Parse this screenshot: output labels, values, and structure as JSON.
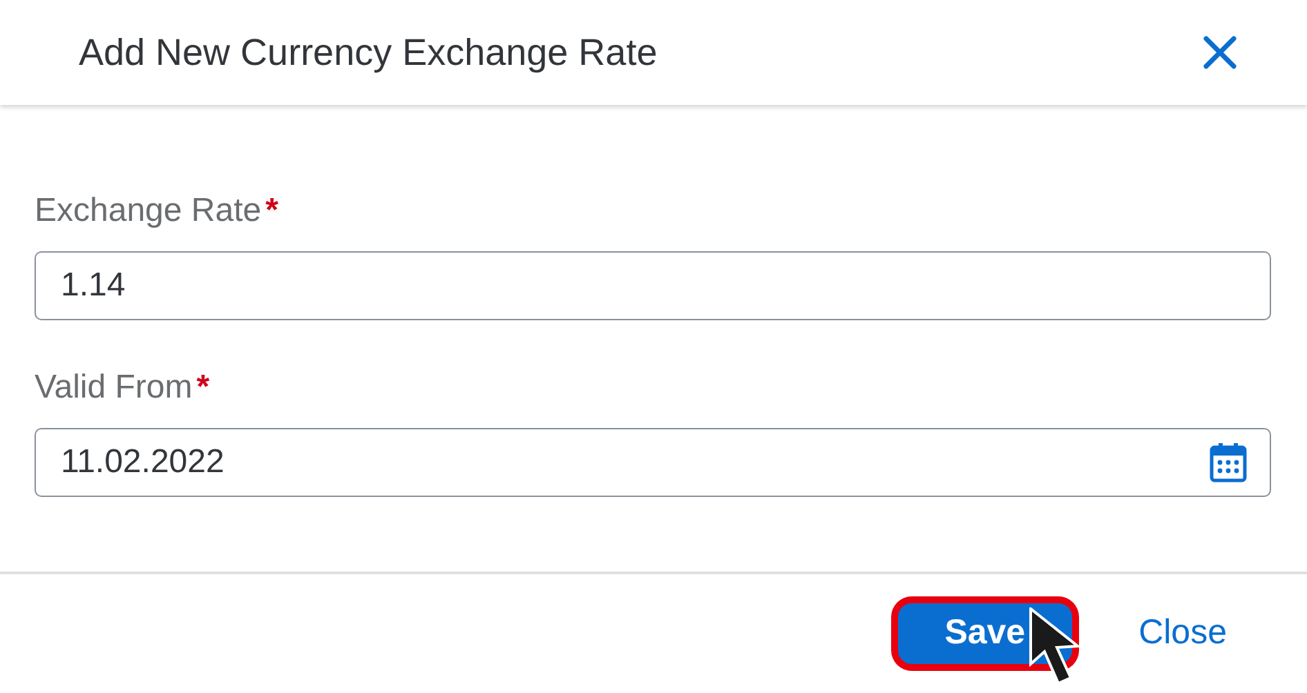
{
  "dialog": {
    "title": "Add New Currency Exchange Rate"
  },
  "fields": [
    {
      "label": "Exchange Rate",
      "required_mark": "*",
      "value": "1.14",
      "kind": "text"
    },
    {
      "label": "Valid From",
      "required_mark": "*",
      "value": "11.02.2022",
      "kind": "date"
    }
  ],
  "buttons": [
    {
      "label": "Save",
      "kind": "primary",
      "highlighted": true
    },
    {
      "label": "Close",
      "kind": "transparent",
      "highlighted": false
    }
  ]
}
